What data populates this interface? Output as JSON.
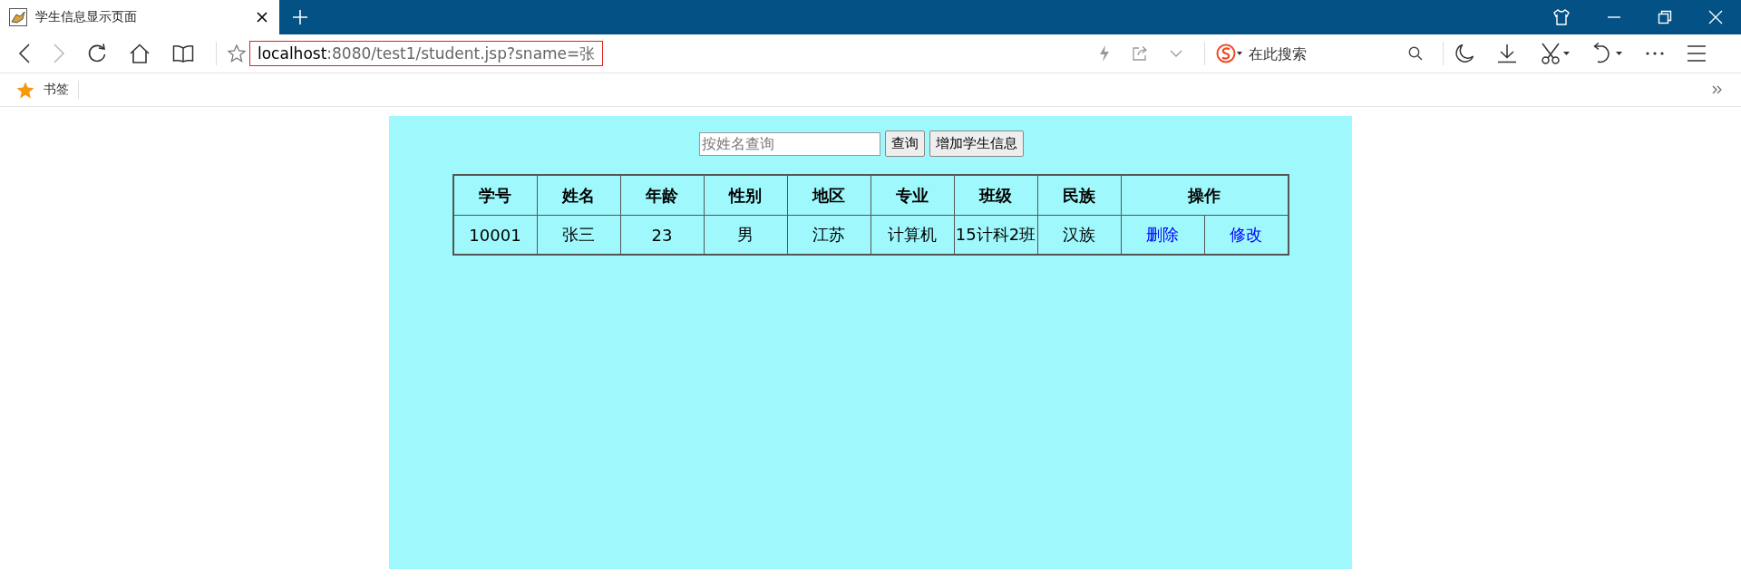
{
  "tab": {
    "title": "学生信息显示页面"
  },
  "address_bar": {
    "host": "localhost",
    "path": ":8080/test1/student.jsp?sname=张"
  },
  "search_box": {
    "placeholder": "在此搜索"
  },
  "bookmarks": [
    {
      "label": "书签"
    }
  ],
  "page": {
    "search": {
      "placeholder": "按姓名查询"
    },
    "buttons": [
      "查询",
      "增加学生信息"
    ],
    "table": {
      "columns": [
        "学号",
        "姓名",
        "年龄",
        "性别",
        "地区",
        "专业",
        "班级",
        "民族",
        "操作"
      ],
      "rows": [
        {
          "cells": [
            "10001",
            "张三",
            "23",
            "男",
            "江苏",
            "计算机",
            "15计科2班",
            "汉族"
          ],
          "actions": [
            "删除",
            "修改"
          ]
        }
      ]
    }
  }
}
